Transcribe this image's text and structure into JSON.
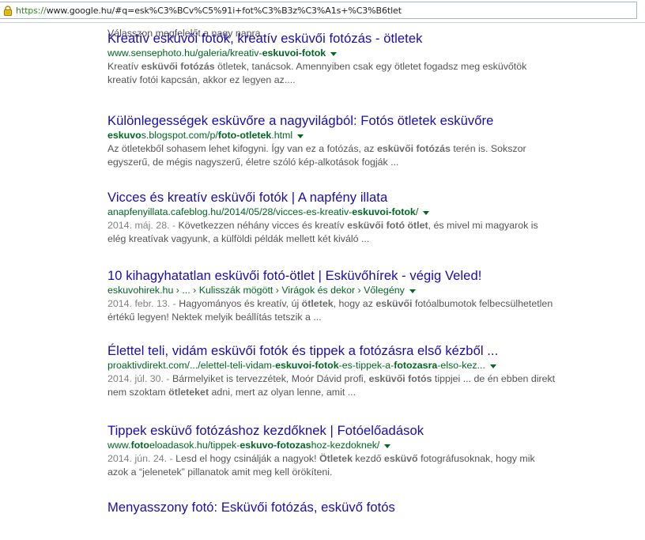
{
  "browser": {
    "url_scheme": "https://",
    "url_rest": "www.google.hu/#q=esk%C3%BCv%C5%91i+fot%C3%B3z%C3%A1s+%C3%B6tlet",
    "lock_icon": "padlock-icon"
  },
  "previous_snippet": "Válasszon megfelelőt a nagy napra.",
  "results": [
    {
      "title": "Kreatív esküvői fotók, kreatív esküvői fotózás - ötletek",
      "url": [
        {
          "t": "www.sensephoto.hu/galeria/kreativ-",
          "b": false
        },
        {
          "t": "eskuvoi-fotok",
          "b": true
        }
      ],
      "snippet": [
        [
          {
            "t": "Kreatív ",
            "b": false
          },
          {
            "t": "esküvői fotózás",
            "b": true
          },
          {
            "t": " ötletek, tanácsok. Amennyiben csak egy ötletet fogadsz meg esküvőtök",
            "b": false
          }
        ],
        [
          {
            "t": "kreatív fotói kapcsán, akkor ez legyen az....",
            "b": false
          }
        ]
      ]
    },
    {
      "title": "Különlegességek esküvőre a nagyvilágból: Fotós ötletek esküvőre",
      "url": [
        {
          "t": "eskuvo",
          "b": true
        },
        {
          "t": "s.blogspot.com/p/",
          "b": false
        },
        {
          "t": "foto-otletek",
          "b": true
        },
        {
          "t": ".html",
          "b": false
        }
      ],
      "snippet": [
        [
          {
            "t": "Az ötletekből sohasem lehet kifogyni. Így van ez a fotózás, az ",
            "b": false
          },
          {
            "t": "esküvői fotózás",
            "b": true
          },
          {
            "t": " terén is. Sokszor",
            "b": false
          }
        ],
        [
          {
            "t": "egyszerű, de mégis nagyszerű, életre szóló kép-alkotások fogják ...",
            "b": false
          }
        ]
      ]
    },
    {
      "title": "Vicces és kreatív esküvői fotók | A napfény illata",
      "url": [
        {
          "t": "anapfenyillata.cafeblog.hu/2014/05/28/vicces-es-kreativ-",
          "b": false
        },
        {
          "t": "eskuvoi-fotok",
          "b": true
        },
        {
          "t": "/",
          "b": false
        }
      ],
      "snippet": [
        [
          {
            "t": "2014. máj. 28. - ",
            "d": true
          },
          {
            "t": "Következzen néhány vicces és kreatív ",
            "b": false
          },
          {
            "t": "esküvői fotó ötlet",
            "b": true
          },
          {
            "t": ", és mivel mi magyarok is",
            "b": false
          }
        ],
        [
          {
            "t": "elég kreatívak vagyunk, a külföldi példák mellett két kiváló ...",
            "b": false
          }
        ]
      ]
    },
    {
      "title": "10 kihagyhatatlan esküvői fotó-ötlet | Esküvőhírek - végig Veled!",
      "url": [
        {
          "t": "eskuvohirek.hu › ... › Kulisszák mögött › Virágok és dekor › Vőlegény",
          "b": false
        }
      ],
      "snippet": [
        [
          {
            "t": "2014. febr. 13. - ",
            "d": true
          },
          {
            "t": "Hagyományos és kreatív, új ",
            "b": false
          },
          {
            "t": "ötletek",
            "b": true
          },
          {
            "t": ", hogy az ",
            "b": false
          },
          {
            "t": "esküvői",
            "b": true
          },
          {
            "t": " fotóalbumotok felbecsülhetetlen",
            "b": false
          }
        ],
        [
          {
            "t": "értékű legyen! Nektek melyik beállítás tetszik a ...",
            "b": false
          }
        ]
      ]
    },
    {
      "title": "Élettel teli, vidám esküvői fotók és tippek a fotózásra első kézből ...",
      "url": [
        {
          "t": "proaktivdirekt.com/.../elettel-teli-vidam-",
          "b": false
        },
        {
          "t": "eskuvoi-fotok",
          "b": true
        },
        {
          "t": "-es-tippek-a-",
          "b": false
        },
        {
          "t": "fotozasra",
          "b": true
        },
        {
          "t": "-elso-kez...",
          "b": false
        }
      ],
      "snippet": [
        [
          {
            "t": "2014. júl. 30. - ",
            "d": true
          },
          {
            "t": "Bármelyiket is tervezzétek, Moór Dávid profi, ",
            "b": false
          },
          {
            "t": "esküvői fotós",
            "b": true
          },
          {
            "t": " tippjei ... de én ebben direkt",
            "b": false
          }
        ],
        [
          {
            "t": "nem szoktam ",
            "b": false
          },
          {
            "t": "ötleteket",
            "b": true
          },
          {
            "t": " adni, mert az olyan lenne, amit ...",
            "b": false
          }
        ]
      ]
    },
    {
      "title": "Tippek esküvő fotózáshoz kezdőknek | Fotóelőadások",
      "url": [
        {
          "t": "www.",
          "b": false
        },
        {
          "t": "foto",
          "b": true
        },
        {
          "t": "eloadasok.hu/tippek-",
          "b": false
        },
        {
          "t": "eskuvo-fotozas",
          "b": true
        },
        {
          "t": "hoz-kezdoknek/",
          "b": false
        }
      ],
      "snippet": [
        [
          {
            "t": "2014. jún. 24. - ",
            "d": true
          },
          {
            "t": "Lesd el hogy csinálják a nagyok! ",
            "b": false
          },
          {
            "t": "Ötletek",
            "b": true
          },
          {
            "t": " kezdő ",
            "b": false
          },
          {
            "t": "esküvő",
            "b": true
          },
          {
            "t": " fotográfusoknak, hogy mik",
            "b": false
          }
        ],
        [
          {
            "t": "azok a “jelenetek” pillanatok amit meg kell örökíteni.",
            "b": false
          }
        ]
      ]
    },
    {
      "title": "Menyasszony fotó: Esküvői fotózás, esküvő fotós",
      "url": [],
      "snippet": []
    }
  ],
  "colors": {
    "title": "#1a0dab",
    "url": "#006621",
    "snippet": "#545454",
    "https": "#2c8a1c"
  }
}
